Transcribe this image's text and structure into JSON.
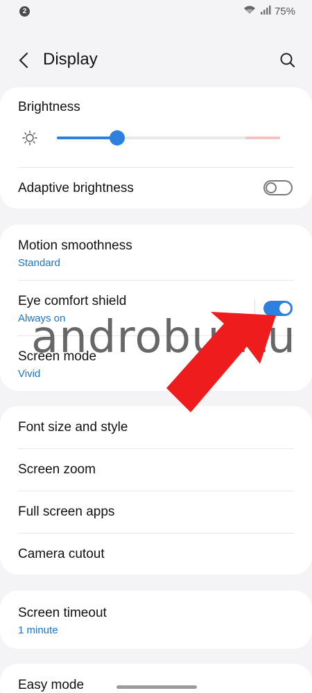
{
  "status_bar": {
    "notification_count": "2",
    "battery": "75%"
  },
  "header": {
    "title": "Display"
  },
  "card1": {
    "brightness_label": "Brightness",
    "brightness_level": 0.27,
    "adaptive_label": "Adaptive brightness",
    "adaptive_on": false
  },
  "card2": {
    "motion_label": "Motion smoothness",
    "motion_value": "Standard",
    "eye_label": "Eye comfort shield",
    "eye_value": "Always on",
    "eye_on": true,
    "screen_mode_label": "Screen mode",
    "screen_mode_value": "Vivid"
  },
  "card3": {
    "items": [
      "Font size and style",
      "Screen zoom",
      "Full screen apps",
      "Camera cutout"
    ]
  },
  "card4": {
    "timeout_label": "Screen timeout",
    "timeout_value": "1 minute"
  },
  "card5": {
    "easy_mode_label": "Easy mode"
  },
  "watermark": "androbuntu",
  "colors": {
    "accent": "#2d7fe0",
    "subtext": "#1a73c9",
    "arrow": "#ee1c1c"
  }
}
